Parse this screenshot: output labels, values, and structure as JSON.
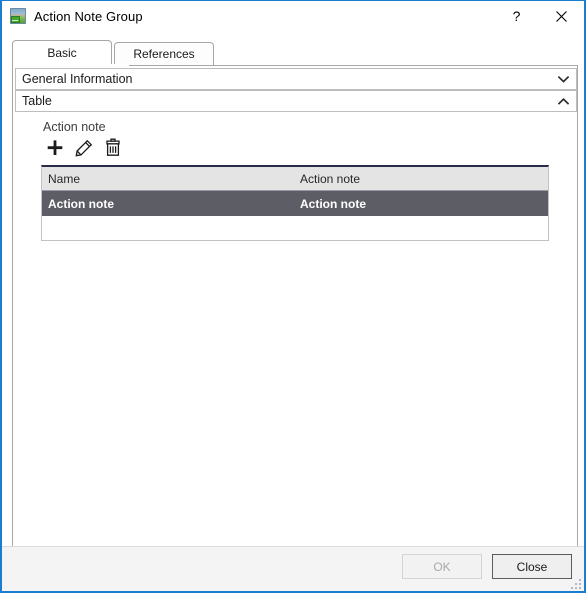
{
  "window": {
    "title": "Action Note Group",
    "icon": "application-icon",
    "help_label": "?",
    "close_label": "✕"
  },
  "tabs": [
    {
      "label": "Basic",
      "selected": true
    },
    {
      "label": "References",
      "selected": false
    }
  ],
  "expanders": [
    {
      "label": "General Information",
      "state": "collapsed",
      "chevron": "chevron-down-icon"
    },
    {
      "label": "Table",
      "state": "expanded",
      "chevron": "chevron-up-icon"
    }
  ],
  "group": {
    "label": "Action note",
    "toolbar": [
      {
        "name": "add-icon",
        "tooltip": "Add"
      },
      {
        "name": "edit-icon",
        "tooltip": "Edit"
      },
      {
        "name": "delete-icon",
        "tooltip": "Delete"
      }
    ]
  },
  "grid": {
    "columns": [
      "Name",
      "Action note"
    ],
    "rows": [
      {
        "cells": [
          "Action note",
          "Action note"
        ],
        "selected": true
      }
    ],
    "selection_color": "#5d5d66",
    "header_color": "#e4e4e4"
  },
  "footer": {
    "ok_label": "OK",
    "ok_enabled": false,
    "close_label": "Close",
    "close_enabled": true
  },
  "colors": {
    "window_border": "#1a7ed0",
    "accent": "#1a7ed0"
  }
}
